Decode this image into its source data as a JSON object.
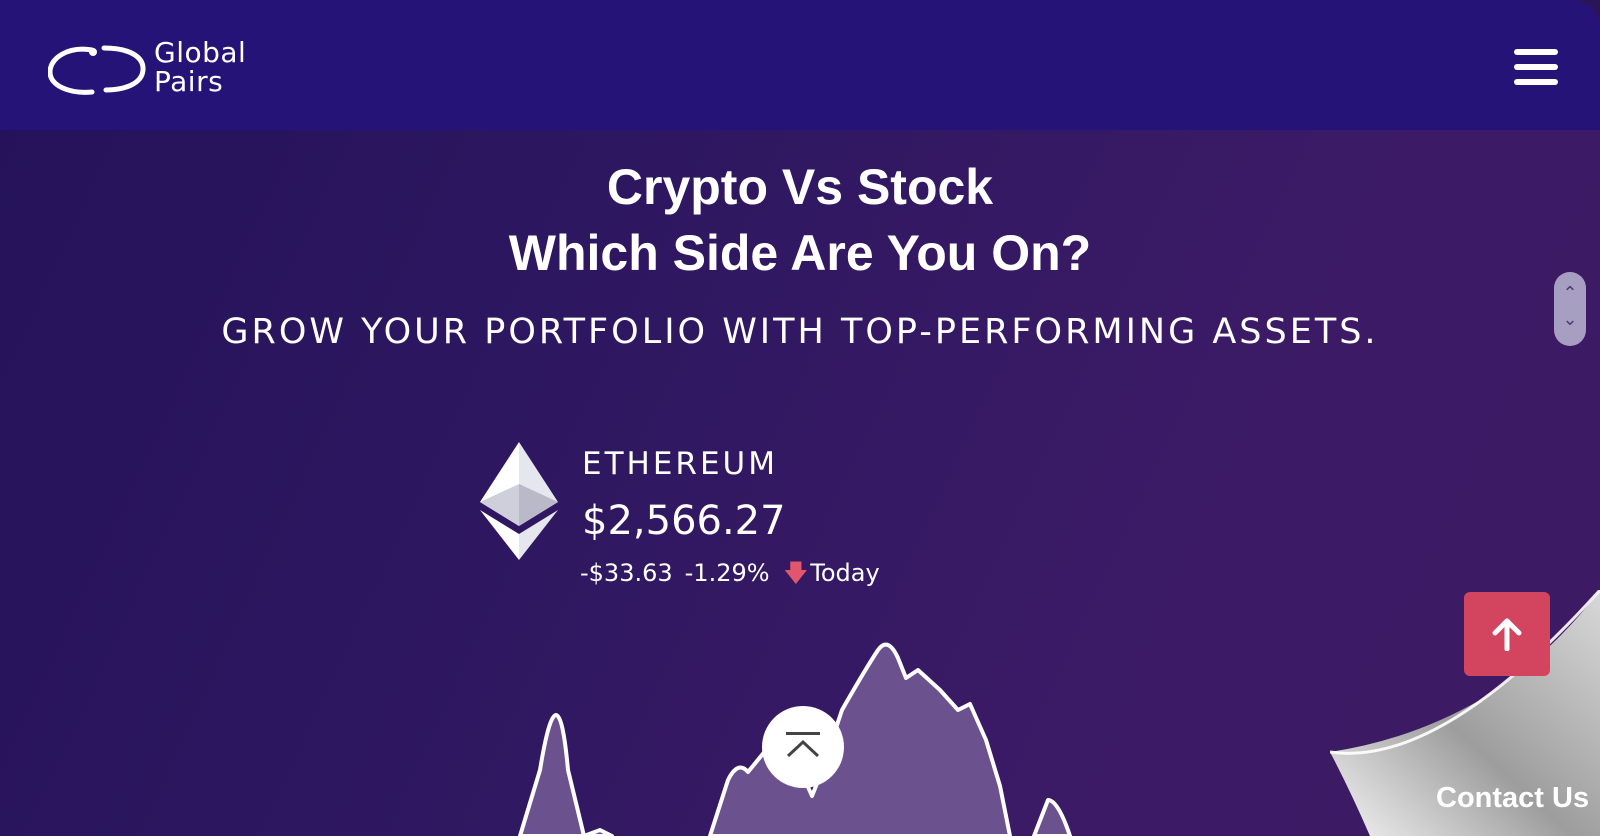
{
  "header": {
    "logo_line1": "Global",
    "logo_line2": "Pairs",
    "menu_icon": "hamburger-menu-icon"
  },
  "hero": {
    "title_line1": "Crypto Vs Stock",
    "title_line2": "Which Side Are You On?",
    "subtitle": "GROW YOUR PORTFOLIO WITH TOP-PERFORMING ASSETS."
  },
  "asset": {
    "icon": "ethereum-icon",
    "name": "ETHEREUM",
    "price": "$2,566.27",
    "change": "-$33.63",
    "change_pct": "-1.29%",
    "period": "Today",
    "trend_icon": "arrow-down-icon"
  },
  "scroll_control": {
    "up_icon": "chevron-up-icon",
    "down_icon": "chevron-down-icon"
  },
  "back_to_top_icon": "back-to-top-icon",
  "up_button_icon": "arrow-up-icon",
  "contact": {
    "label": "Contact Us"
  },
  "colors": {
    "header_bg": "#251378",
    "page_bg": "#2d1760",
    "accent_red": "#d3455e",
    "chart_fill": "#6b528f"
  }
}
